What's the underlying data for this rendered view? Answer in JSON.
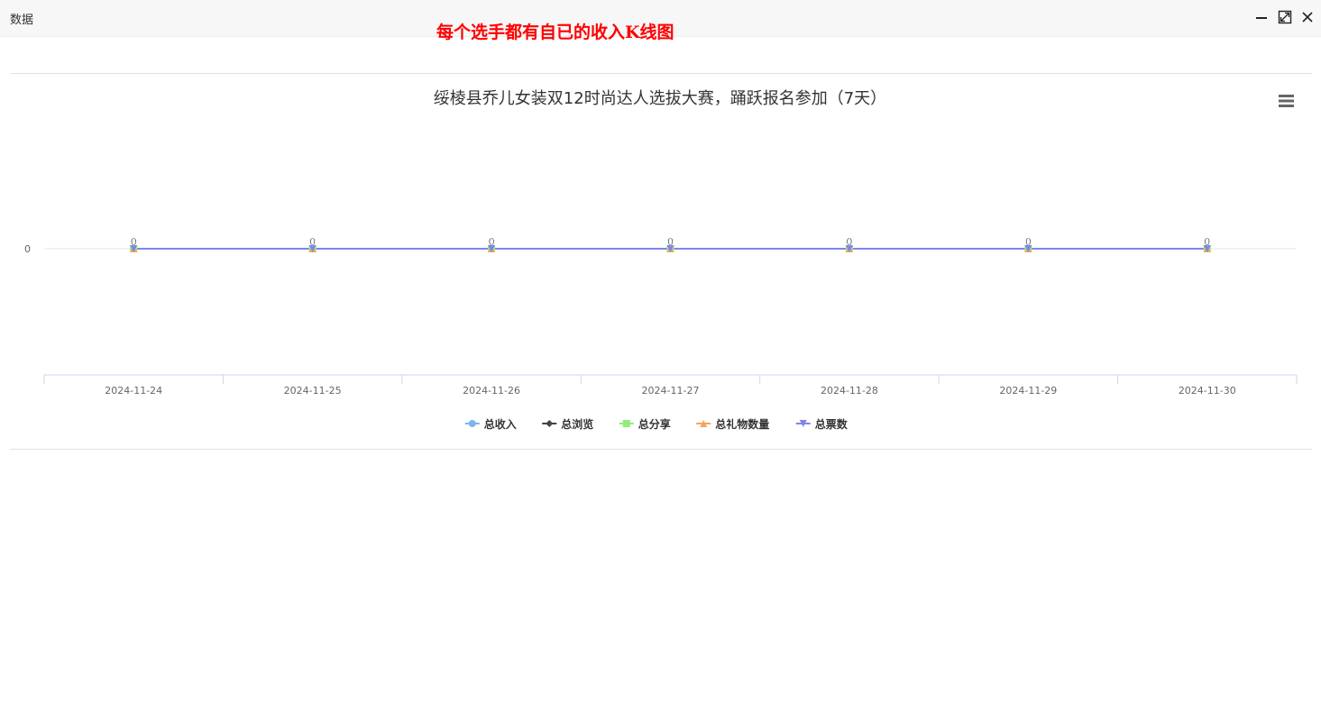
{
  "window": {
    "title": "数据",
    "annotation": "每个选手都有自已的收入K线图",
    "controls": [
      "minimize-icon",
      "maximize-icon",
      "close-icon"
    ]
  },
  "chart_menu_icon": "hamburger-menu-icon",
  "colors": {
    "title_text": "#333333",
    "annotation": "#ff0000",
    "axis": "#ccd6eb",
    "grid": "#e6e6e6"
  },
  "chart_data": {
    "type": "line",
    "title": "绥棱县乔儿女装双12时尚达人选拔大赛，踊跃报名参加（7天）",
    "categories": [
      "2024-11-24",
      "2024-11-25",
      "2024-11-26",
      "2024-11-27",
      "2024-11-28",
      "2024-11-29",
      "2024-11-30"
    ],
    "y_ticks": [
      "0"
    ],
    "data_labels": true,
    "legend_position": "bottom-center",
    "series": [
      {
        "name": "总收入",
        "color": "#7cb5ec",
        "marker": "circle",
        "values": [
          0,
          0,
          0,
          0,
          0,
          0,
          0
        ]
      },
      {
        "name": "总浏览",
        "color": "#434348",
        "marker": "diamond",
        "values": [
          0,
          0,
          0,
          0,
          0,
          0,
          0
        ]
      },
      {
        "name": "总分享",
        "color": "#90ed7d",
        "marker": "square",
        "values": [
          0,
          0,
          0,
          0,
          0,
          0,
          0
        ]
      },
      {
        "name": "总礼物数量",
        "color": "#f7a35c",
        "marker": "triangle",
        "values": [
          0,
          0,
          0,
          0,
          0,
          0,
          0
        ]
      },
      {
        "name": "总票数",
        "color": "#8085e9",
        "marker": "triangle-down",
        "values": [
          0,
          0,
          0,
          0,
          0,
          0,
          0
        ]
      }
    ]
  }
}
